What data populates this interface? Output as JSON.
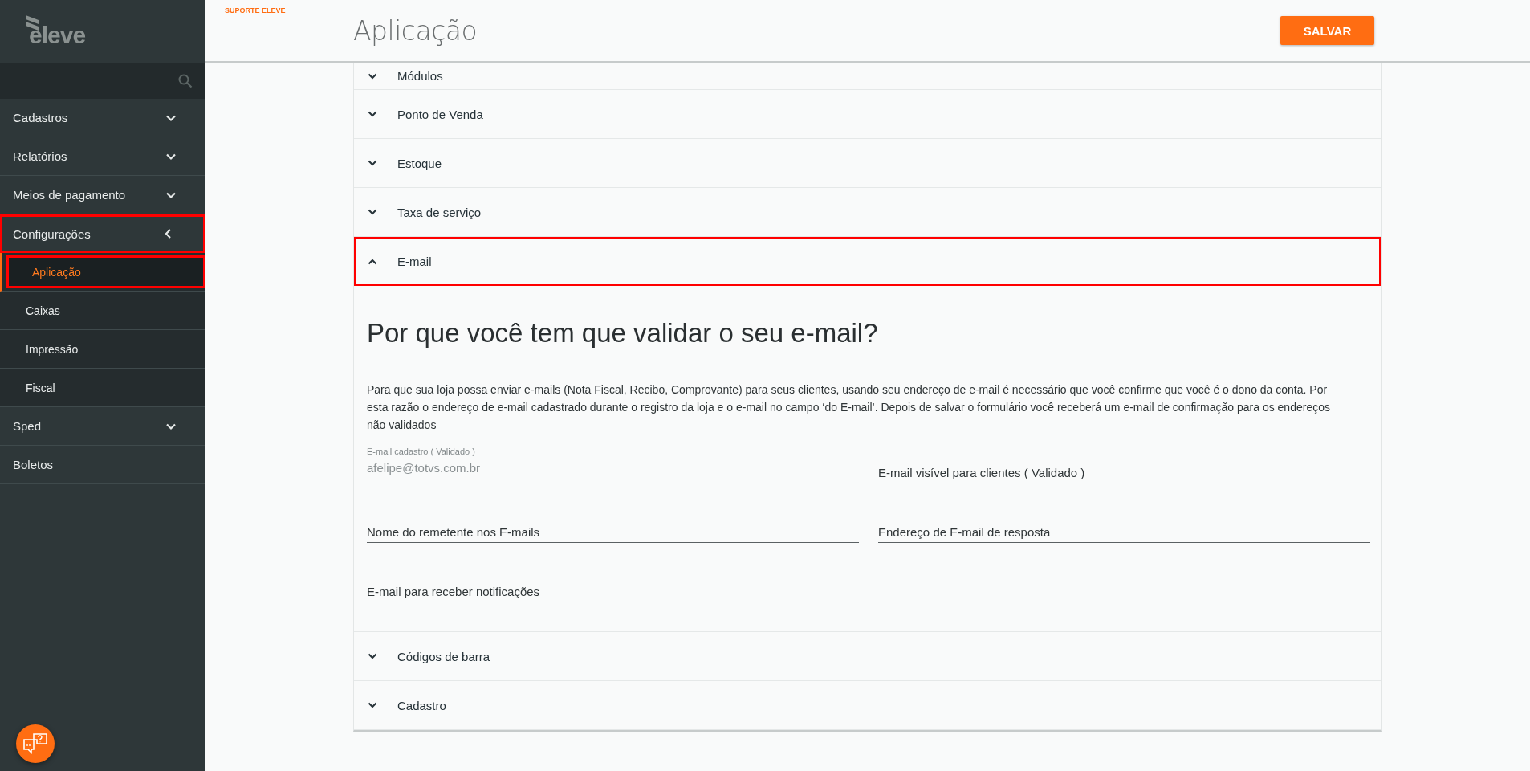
{
  "sidebar": {
    "logo": "eleve",
    "items": [
      {
        "label": "Cadastros",
        "kind": "group",
        "expanded": false,
        "highlighted": false
      },
      {
        "label": "Relatórios",
        "kind": "group",
        "expanded": false,
        "highlighted": false
      },
      {
        "label": "Meios de pagamento",
        "kind": "group",
        "expanded": false,
        "highlighted": false
      },
      {
        "label": "Configurações",
        "kind": "group",
        "expanded": true,
        "highlighted": true,
        "children": [
          {
            "label": "Aplicação",
            "selected": true,
            "highlighted": true
          },
          {
            "label": "Caixas",
            "selected": false,
            "highlighted": false
          },
          {
            "label": "Impressão",
            "selected": false,
            "highlighted": false
          },
          {
            "label": "Fiscal",
            "selected": false,
            "highlighted": false
          }
        ]
      },
      {
        "label": "Sped",
        "kind": "group",
        "expanded": false,
        "highlighted": false
      },
      {
        "label": "Boletos",
        "kind": "link",
        "highlighted": false
      }
    ]
  },
  "header": {
    "support": "SUPORTE ELEVE",
    "title": "Aplicação",
    "save": "SALVAR"
  },
  "sections": [
    {
      "label": "Módulos",
      "expanded": false,
      "highlighted": false
    },
    {
      "label": "Ponto de Venda",
      "expanded": false,
      "highlighted": false
    },
    {
      "label": "Estoque",
      "expanded": false,
      "highlighted": false
    },
    {
      "label": "Taxa de serviço",
      "expanded": false,
      "highlighted": false
    },
    {
      "label": "E-mail",
      "expanded": true,
      "highlighted": true,
      "heading": "Por que você tem que validar o seu e-mail?",
      "text": "Para que sua loja possa enviar e-mails (Nota Fiscal, Recibo, Comprovante) para seus clientes, usando seu endereço de e-mail é necessário que você confirme que você é o dono da conta. Por esta razão o endereço de e-mail cadastrado durante o registro da loja e o e-mail no campo ‘do E-mail’. Depois de salvar o formulário você receberá um e-mail de confirmação para os endereços não validados",
      "fields": [
        {
          "label": "E-mail cadastro ( Validado )",
          "value": "afelipe@totvs.com.br"
        },
        {
          "label": "E-mail visível para clientes ( Validado )"
        },
        {
          "label": "Nome do remetente nos E-mails"
        },
        {
          "label": "Endereço de E-mail de resposta"
        },
        {
          "label": "E-mail para receber notificações"
        }
      ]
    },
    {
      "label": "Códigos de barra",
      "expanded": false,
      "highlighted": false
    },
    {
      "label": "Cadastro",
      "expanded": false,
      "highlighted": false
    }
  ]
}
